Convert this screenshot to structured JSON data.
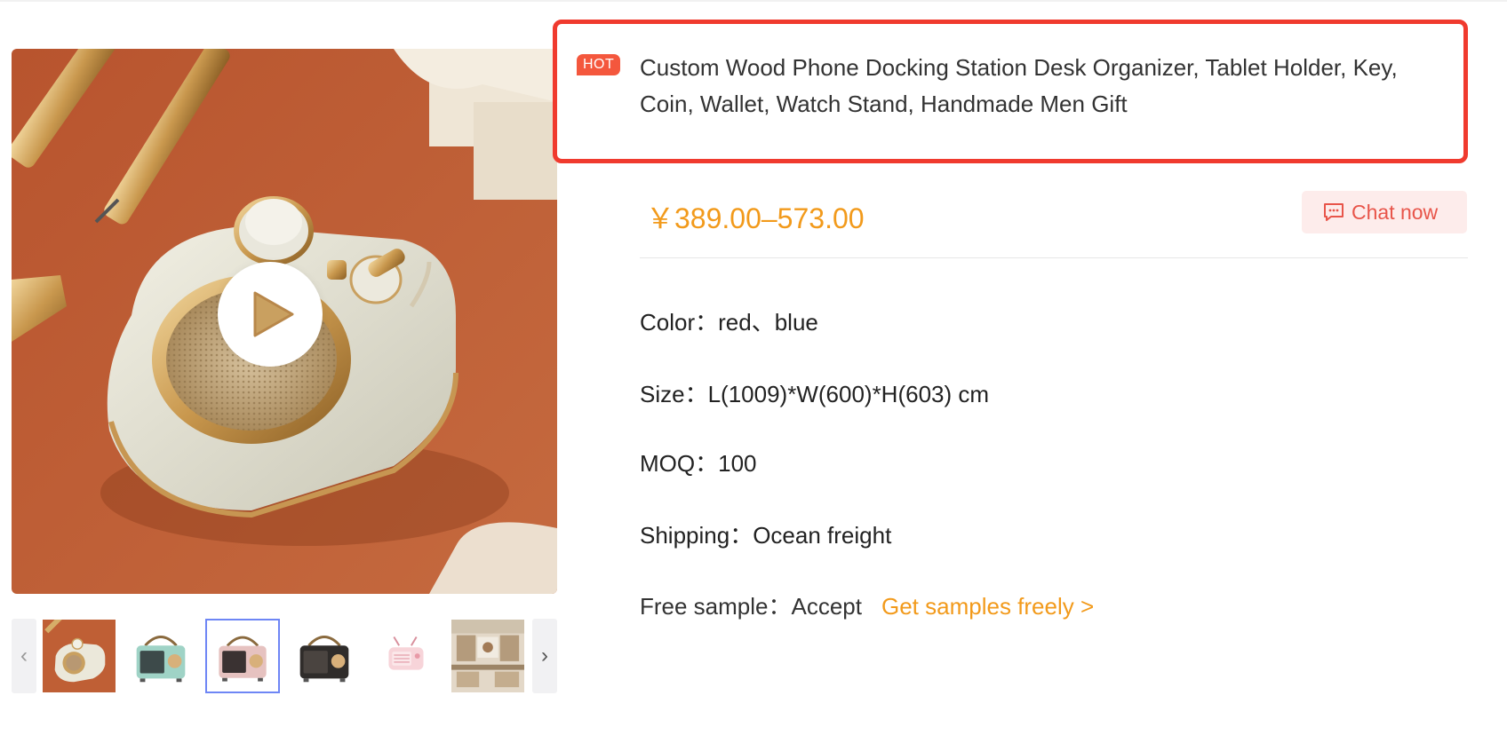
{
  "product": {
    "badge": "HOT",
    "title": "Custom Wood Phone Docking Station Desk Organizer, Tablet Holder, Key, Coin, Wallet, Watch Stand, Handmade Men Gift",
    "price": "￥389.00–573.00",
    "chat_label": "Chat now"
  },
  "attributes": {
    "color_label": "Color：",
    "color_value": "red、blue",
    "size_label": "Size：",
    "size_value": "L(1009)*W(600)*H(603) cm",
    "moq_label": "MOQ：",
    "moq_value": "100",
    "shipping_label": "Shipping：",
    "shipping_value": "Ocean freight",
    "sample_label": "Free sample：",
    "sample_value": "Accept",
    "sample_link": "Get samples freely >"
  },
  "gallery": {
    "prev_arrow": "‹",
    "next_arrow": "›",
    "active_thumbnail": 3,
    "thumbnails": [
      {
        "icon": "camera-speaker-thumbnail"
      },
      {
        "icon": "mint-radio-thumbnail"
      },
      {
        "icon": "pink-radio-thumbnail"
      },
      {
        "icon": "black-radio-thumbnail"
      },
      {
        "icon": "pink-tv-speaker-thumbnail"
      },
      {
        "icon": "room-scene-thumbnail"
      }
    ]
  },
  "colors": {
    "accent_orange": "#f29a1b",
    "highlight_red": "#f03a2e",
    "hot_badge": "#f4573d",
    "chat_bg": "#fdeceb",
    "active_thumb_border": "#6e86f5"
  }
}
